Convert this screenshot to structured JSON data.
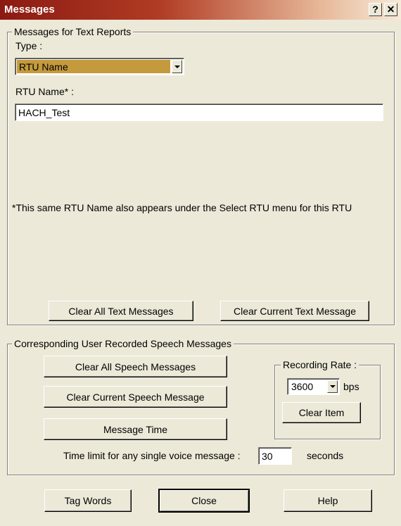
{
  "window": {
    "title": "Messages",
    "help_glyph": "?",
    "close_glyph": "✕"
  },
  "text_reports": {
    "group_label": "Messages for Text Reports",
    "type_label": "Type :",
    "type_value": "RTU Name",
    "rtu_name_label": "RTU Name* :",
    "rtu_name_value": "HACH_Test",
    "note": "*This same RTU Name also appears under the Select RTU menu for this RTU",
    "clear_all_label": "Clear All Text Messages",
    "clear_current_label": "Clear Current Text Message"
  },
  "speech": {
    "group_label": "Corresponding User Recorded Speech Messages",
    "clear_all_label": "Clear All Speech Messages",
    "clear_current_label": "Clear Current Speech Message",
    "message_time_label": "Message Time",
    "recording_rate": {
      "group_label": "Recording Rate :",
      "value": "3600",
      "unit": "bps",
      "clear_item_label": "Clear Item"
    },
    "time_limit_label": "Time limit for any single voice message :",
    "time_limit_value": "30",
    "time_limit_unit": "seconds"
  },
  "footer": {
    "tag_words_label": "Tag Words",
    "close_label": "Close",
    "help_label": "Help"
  },
  "colors": {
    "title_start": "#8b1a12",
    "title_end": "#f6ead8",
    "face": "#ece9d8",
    "combo_highlight": "#c49a3c"
  }
}
